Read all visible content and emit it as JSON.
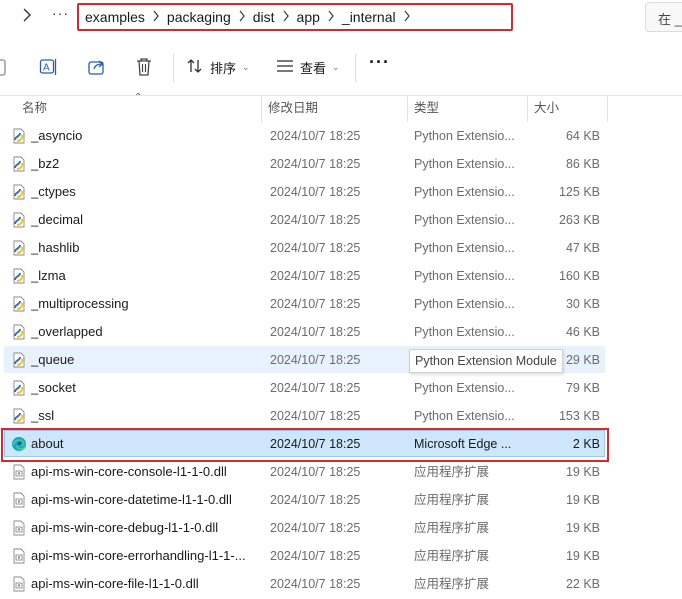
{
  "address_bar": {
    "crumbs": [
      "examples",
      "packaging",
      "dist",
      "app",
      "_internal"
    ],
    "search_text": "在 _"
  },
  "toolbar": {
    "sort_label": "排序",
    "view_label": "查看",
    "more_label": "···"
  },
  "columns": {
    "name": "名称",
    "date": "修改日期",
    "type": "类型",
    "size": "大小"
  },
  "files": [
    {
      "name": "_asyncio",
      "date": "2024/10/7 18:25",
      "type": "Python Extensio...",
      "size": "64 KB",
      "icon": "python-extension-icon"
    },
    {
      "name": "_bz2",
      "date": "2024/10/7 18:25",
      "type": "Python Extensio...",
      "size": "86 KB",
      "icon": "python-extension-icon"
    },
    {
      "name": "_ctypes",
      "date": "2024/10/7 18:25",
      "type": "Python Extensio...",
      "size": "125 KB",
      "icon": "python-extension-icon"
    },
    {
      "name": "_decimal",
      "date": "2024/10/7 18:25",
      "type": "Python Extensio...",
      "size": "263 KB",
      "icon": "python-extension-icon"
    },
    {
      "name": "_hashlib",
      "date": "2024/10/7 18:25",
      "type": "Python Extensio...",
      "size": "47 KB",
      "icon": "python-extension-icon"
    },
    {
      "name": "_lzma",
      "date": "2024/10/7 18:25",
      "type": "Python Extensio...",
      "size": "160 KB",
      "icon": "python-extension-icon"
    },
    {
      "name": "_multiprocessing",
      "date": "2024/10/7 18:25",
      "type": "Python Extensio...",
      "size": "30 KB",
      "icon": "python-extension-icon"
    },
    {
      "name": "_overlapped",
      "date": "2024/10/7 18:25",
      "type": "Python Extensio...",
      "size": "46 KB",
      "icon": "python-extension-icon"
    },
    {
      "name": "_queue",
      "date": "2024/10/7 18:25",
      "type": "Python Extensio...",
      "size": "29 KB",
      "icon": "python-extension-icon",
      "state": "hover"
    },
    {
      "name": "_socket",
      "date": "2024/10/7 18:25",
      "type": "Python Extensio...",
      "size": "79 KB",
      "icon": "python-extension-icon"
    },
    {
      "name": "_ssl",
      "date": "2024/10/7 18:25",
      "type": "Python Extensio...",
      "size": "153 KB",
      "icon": "python-extension-icon"
    },
    {
      "name": "about",
      "date": "2024/10/7 18:25",
      "type": "Microsoft Edge ...",
      "size": "2 KB",
      "icon": "edge-html-icon",
      "state": "selected"
    },
    {
      "name": "api-ms-win-core-console-l1-1-0.dll",
      "date": "2024/10/7 18:25",
      "type": "应用程序扩展",
      "size": "19 KB",
      "icon": "dll-file-icon"
    },
    {
      "name": "api-ms-win-core-datetime-l1-1-0.dll",
      "date": "2024/10/7 18:25",
      "type": "应用程序扩展",
      "size": "19 KB",
      "icon": "dll-file-icon"
    },
    {
      "name": "api-ms-win-core-debug-l1-1-0.dll",
      "date": "2024/10/7 18:25",
      "type": "应用程序扩展",
      "size": "19 KB",
      "icon": "dll-file-icon"
    },
    {
      "name": "api-ms-win-core-errorhandling-l1-1-...",
      "date": "2024/10/7 18:25",
      "type": "应用程序扩展",
      "size": "19 KB",
      "icon": "dll-file-icon"
    },
    {
      "name": "api-ms-win-core-file-l1-1-0.dll",
      "date": "2024/10/7 18:25",
      "type": "应用程序扩展",
      "size": "22 KB",
      "icon": "dll-file-icon"
    }
  ],
  "tooltip": "Python Extension Module",
  "colors": {
    "highlight_border": "#d9272e",
    "selected_bg": "#cde6fb",
    "hover_bg": "#e8f2fc"
  }
}
